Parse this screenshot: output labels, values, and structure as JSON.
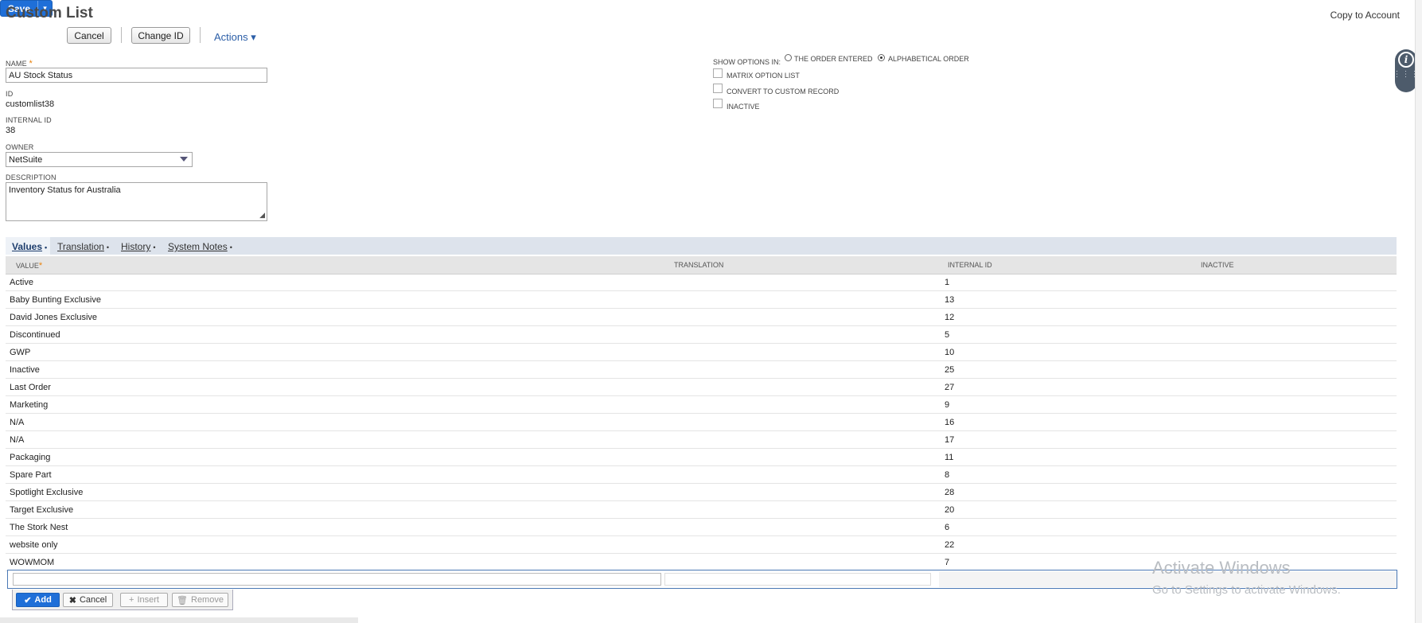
{
  "header": {
    "title": "Custom List",
    "copy_to_account": "Copy to Account"
  },
  "toolbar": {
    "save": "Save",
    "save_arrow": "▾",
    "cancel": "Cancel",
    "change_id": "Change ID",
    "actions": "Actions ▾"
  },
  "form": {
    "name_label": "NAME",
    "required_mark": "*",
    "name_value": "AU Stock Status",
    "id_label": "ID",
    "id_value": "customlist38",
    "internal_id_label": "INTERNAL ID",
    "internal_id_value": "38",
    "owner_label": "OWNER",
    "owner_value": "NetSuite",
    "description_label": "DESCRIPTION",
    "description_value": "Inventory Status for Australia"
  },
  "options": {
    "show_options_label": "SHOW OPTIONS IN:",
    "order_entered": "THE ORDER ENTERED",
    "alphabetical": "ALPHABETICAL ORDER",
    "selected": "alphabetical",
    "matrix_option_list": "MATRIX OPTION LIST",
    "convert_to_custom_record": "CONVERT TO CUSTOM RECORD",
    "inactive": "INACTIVE"
  },
  "tabs": [
    {
      "label": "Values",
      "active": true
    },
    {
      "label": "Translation",
      "active": false
    },
    {
      "label": "History",
      "active": false
    },
    {
      "label": "System Notes",
      "active": false
    }
  ],
  "table": {
    "headers": {
      "value": "VALUE",
      "translation": "TRANSLATION",
      "internal_id": "INTERNAL ID",
      "inactive": "INACTIVE"
    },
    "rows": [
      {
        "value": "Active",
        "id": "1"
      },
      {
        "value": "Baby Bunting Exclusive",
        "id": "13"
      },
      {
        "value": "David Jones Exclusive",
        "id": "12"
      },
      {
        "value": "Discontinued",
        "id": "5"
      },
      {
        "value": "GWP",
        "id": "10"
      },
      {
        "value": "Inactive",
        "id": "25"
      },
      {
        "value": "Last Order",
        "id": "27"
      },
      {
        "value": "Marketing",
        "id": "9"
      },
      {
        "value": "N/A",
        "id": "16"
      },
      {
        "value": "N/A",
        "id": "17"
      },
      {
        "value": "Packaging",
        "id": "11"
      },
      {
        "value": "Spare Part",
        "id": "8"
      },
      {
        "value": "Spotlight Exclusive",
        "id": "28"
      },
      {
        "value": "Target Exclusive",
        "id": "20"
      },
      {
        "value": "The Stork Nest",
        "id": "6"
      },
      {
        "value": "website only",
        "id": "22"
      },
      {
        "value": "WOWMOM",
        "id": "7"
      }
    ]
  },
  "row_actions": {
    "add": "Add",
    "cancel": "Cancel",
    "insert": "Insert",
    "remove": "Remove"
  },
  "watermark": {
    "line1": "Activate Windows",
    "line2": "Go to Settings to activate Windows."
  },
  "icons": {
    "info": "i",
    "grid": "⋮⋮⋮"
  }
}
